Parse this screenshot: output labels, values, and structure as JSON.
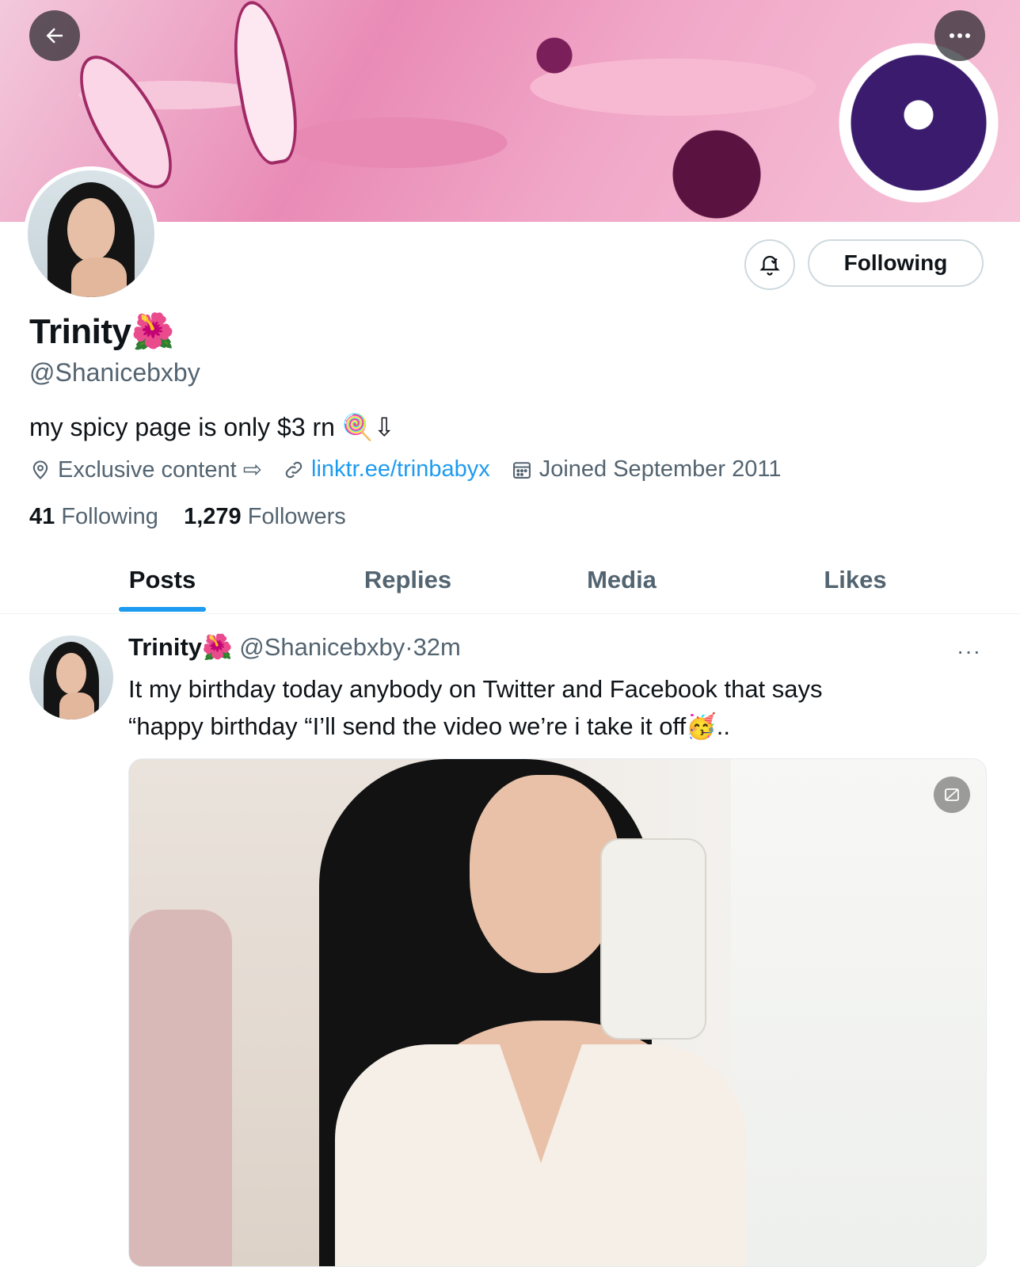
{
  "header": {
    "back_icon": "arrow-left-icon",
    "more_icon": "ellipsis-icon"
  },
  "profile": {
    "name": "Trinity",
    "name_emoji": "🌺",
    "handle": "@Shanicebxby",
    "bio": "my spicy page is only $3 rn 🍭⇩",
    "location": "Exclusive content ⇨",
    "link": "linktr.ee/trinbabyx",
    "joined": "Joined September 2011",
    "following_count": "41",
    "following_label": "Following",
    "followers_count": "1,279",
    "followers_label": "Followers",
    "follow_button": "Following",
    "notify_icon": "bell-check-icon"
  },
  "tabs": [
    {
      "label": "Posts",
      "active": true
    },
    {
      "label": "Replies",
      "active": false
    },
    {
      "label": "Media",
      "active": false
    },
    {
      "label": "Likes",
      "active": false
    }
  ],
  "post": {
    "name": "Trinity",
    "name_emoji": "🌺",
    "handle": "@Shanicebxby",
    "separator": "·",
    "time": "32m",
    "text_line1": "It my birthday today anybody on Twitter and Facebook that says",
    "text_line2": "“happy birthday “I’ll send the video we’re i take it off🥳..",
    "more": "···"
  },
  "colors": {
    "accent": "#1d9bf0",
    "secondary_text": "#536471",
    "border": "#cfd9de"
  }
}
